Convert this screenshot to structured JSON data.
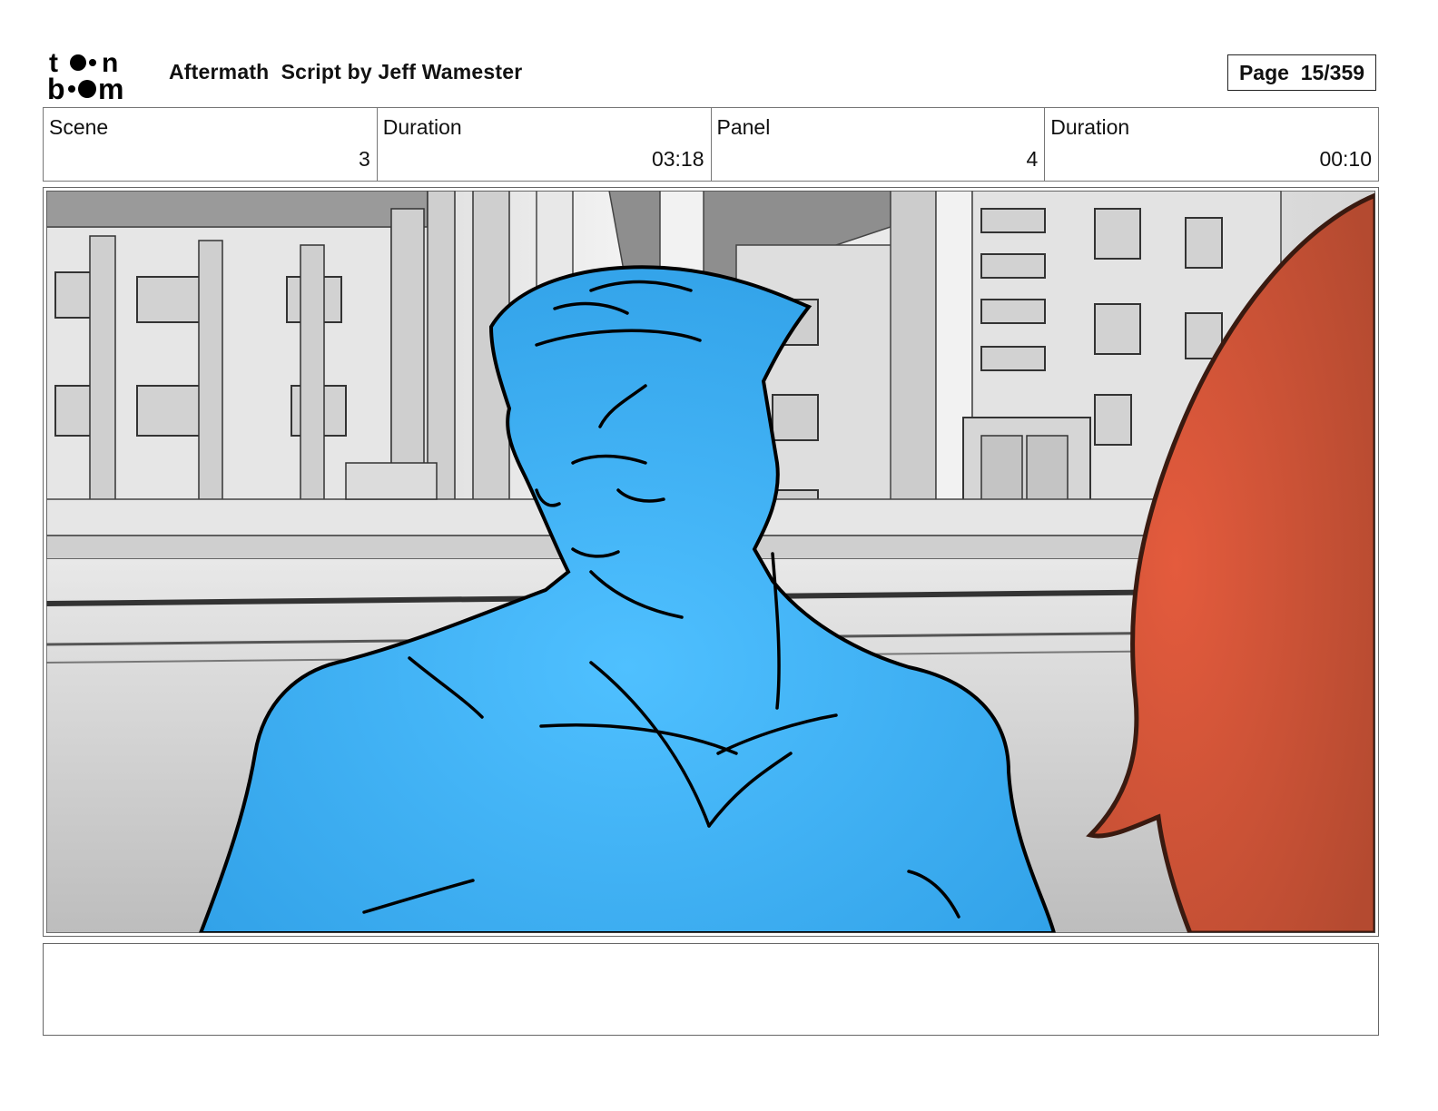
{
  "header": {
    "logo": {
      "top": "t•on",
      "bottom": "b•om"
    },
    "title": "Aftermath  Script by Jeff Wamester",
    "page": "Page  15/359"
  },
  "info": [
    {
      "label": "Scene",
      "value": "3"
    },
    {
      "label": "Duration",
      "value": "03:18"
    },
    {
      "label": "Panel",
      "value": "4"
    },
    {
      "label": "Duration",
      "value": "00:10"
    }
  ],
  "panel": {
    "icon": "storyboard-sketch-image",
    "colors": {
      "character": "#45b7fa",
      "foreground": "#d9573a",
      "background": "#e0e0e0"
    }
  },
  "notes": {
    "text": ""
  }
}
